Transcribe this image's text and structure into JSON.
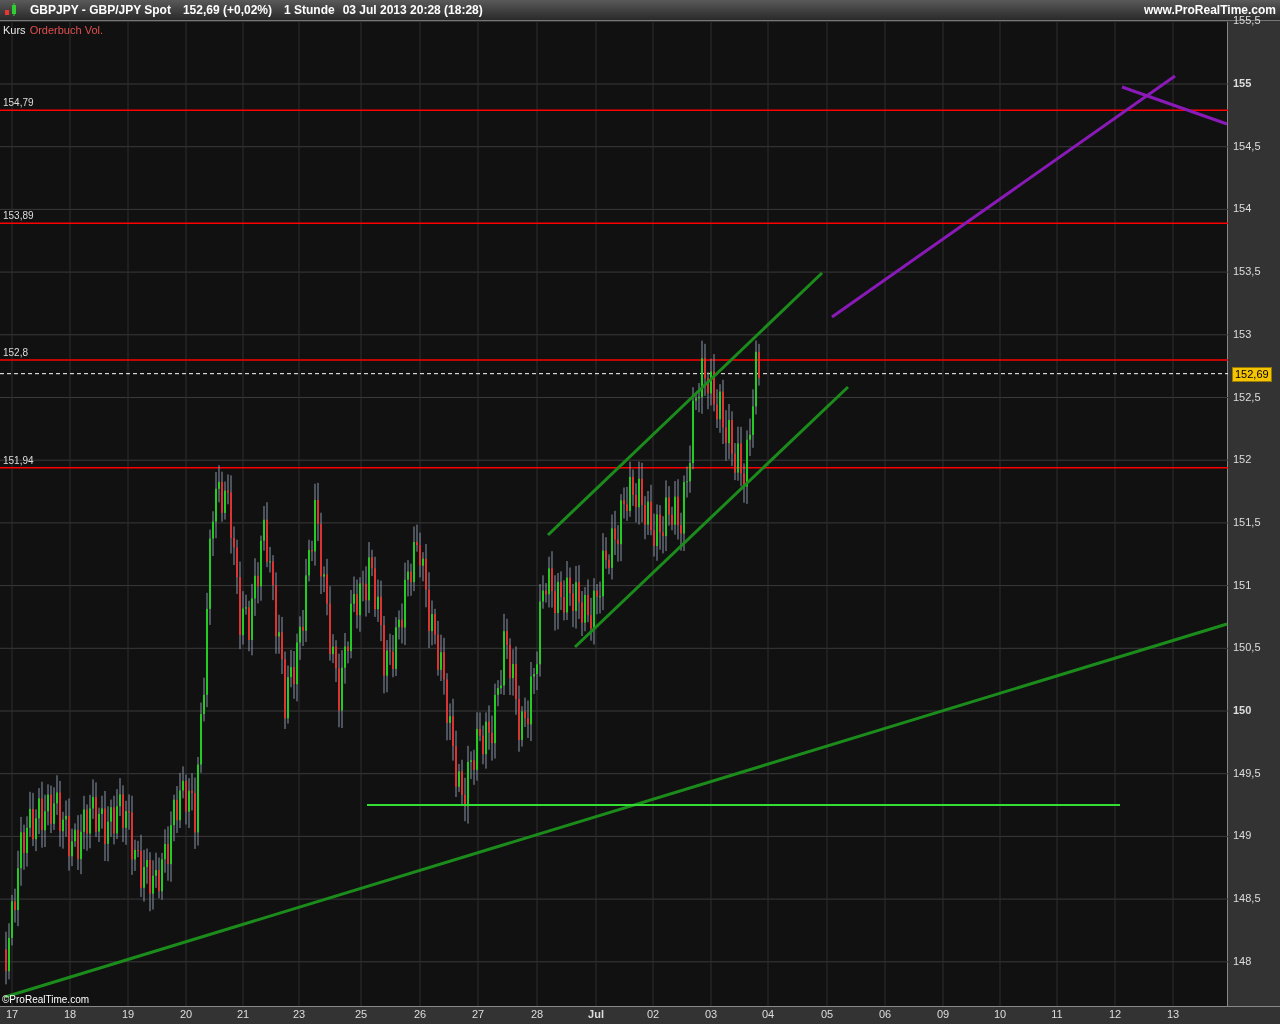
{
  "header": {
    "symbol": "GBPJPY - GBP/JPY Spot",
    "price": "152,69 (+0,02%)",
    "interval": "1 Stunde",
    "datetime": "03 Jul 2013 20:28 (18:28)",
    "website": "www.ProRealTime.com"
  },
  "legend": [
    {
      "label": "Kurs",
      "color": "#e8e8e8"
    },
    {
      "label": "Orderbuch Vol.",
      "color": "#e05050"
    }
  ],
  "levels": [
    {
      "label": "154,79"
    },
    {
      "label": "153,89"
    },
    {
      "label": "152,8"
    },
    {
      "label": "151,94"
    }
  ],
  "current_price": "152,69",
  "y_axis": [
    {
      "label": "155,5",
      "bold": false
    },
    {
      "label": "155",
      "bold": true
    },
    {
      "label": "154,5",
      "bold": false
    },
    {
      "label": "154",
      "bold": false
    },
    {
      "label": "153,5",
      "bold": false
    },
    {
      "label": "153",
      "bold": false
    },
    {
      "label": "152,5",
      "bold": false
    },
    {
      "label": "152",
      "bold": false
    },
    {
      "label": "151,5",
      "bold": false
    },
    {
      "label": "151",
      "bold": false
    },
    {
      "label": "150,5",
      "bold": false
    },
    {
      "label": "150",
      "bold": true
    },
    {
      "label": "149,5",
      "bold": false
    },
    {
      "label": "149",
      "bold": false
    },
    {
      "label": "148,5",
      "bold": false
    },
    {
      "label": "148",
      "bold": false
    }
  ],
  "x_axis": [
    {
      "label": "17",
      "bold": false
    },
    {
      "label": "18",
      "bold": false
    },
    {
      "label": "19",
      "bold": false
    },
    {
      "label": "20",
      "bold": false
    },
    {
      "label": "21",
      "bold": false
    },
    {
      "label": "23",
      "bold": false
    },
    {
      "label": "25",
      "bold": false
    },
    {
      "label": "26",
      "bold": false
    },
    {
      "label": "27",
      "bold": false
    },
    {
      "label": "28",
      "bold": false
    },
    {
      "label": "Jul",
      "bold": true
    },
    {
      "label": "02",
      "bold": false
    },
    {
      "label": "03",
      "bold": false
    },
    {
      "label": "04",
      "bold": false
    },
    {
      "label": "05",
      "bold": false
    },
    {
      "label": "06",
      "bold": false
    },
    {
      "label": "09",
      "bold": false
    },
    {
      "label": "10",
      "bold": false
    },
    {
      "label": "11",
      "bold": false
    },
    {
      "label": "12",
      "bold": false
    },
    {
      "label": "13",
      "bold": false
    }
  ],
  "credit": "©ProRealTime.com"
}
